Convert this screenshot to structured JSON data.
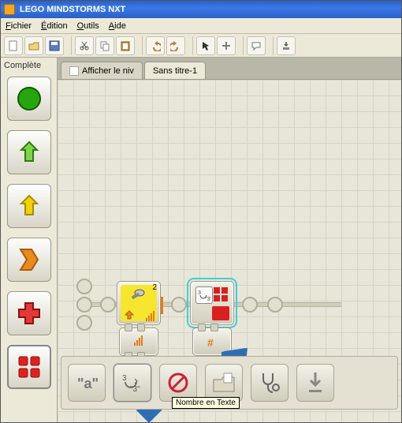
{
  "window": {
    "title": "LEGO MINDSTORMS NXT"
  },
  "menu": {
    "file": "Fichier",
    "edit": "Édition",
    "tools": "Outils",
    "help": "Aide"
  },
  "sidebar": {
    "label": "Complète"
  },
  "tabs": {
    "t1": "Afficher le niv",
    "t2": "Sans titre-1"
  },
  "blocks": {
    "sound": {
      "port": "2"
    }
  },
  "tooltip": "Nombre en Texte",
  "icons": {
    "new": "new-file-icon",
    "open": "open-folder-icon",
    "save": "save-icon",
    "cut": "cut-icon",
    "copy": "copy-icon",
    "paste": "paste-icon",
    "undo": "undo-icon",
    "redo": "redo-icon",
    "pointer": "pointer-icon",
    "pan": "pan-icon",
    "comment": "comment-icon",
    "download": "download-icon"
  },
  "palette": {
    "p1": "green-circle",
    "p2": "green-arrow",
    "p3": "yellow-arrow",
    "p4": "orange-chevron",
    "p5": "red-plus",
    "p6": "red-grid"
  },
  "bottombar": {
    "b1": "text-a",
    "b2": "num-to-text",
    "b3": "no-entry",
    "b4": "open-folder",
    "b5": "diagnose",
    "b6": "download-arrow"
  },
  "colors": {
    "accent_green": "#27a50f",
    "accent_yellow": "#f2d20a",
    "accent_orange": "#e98a1e",
    "accent_red": "#d82020",
    "select_cyan": "#40cfd8",
    "arrow_blue": "#2e6fb4"
  }
}
